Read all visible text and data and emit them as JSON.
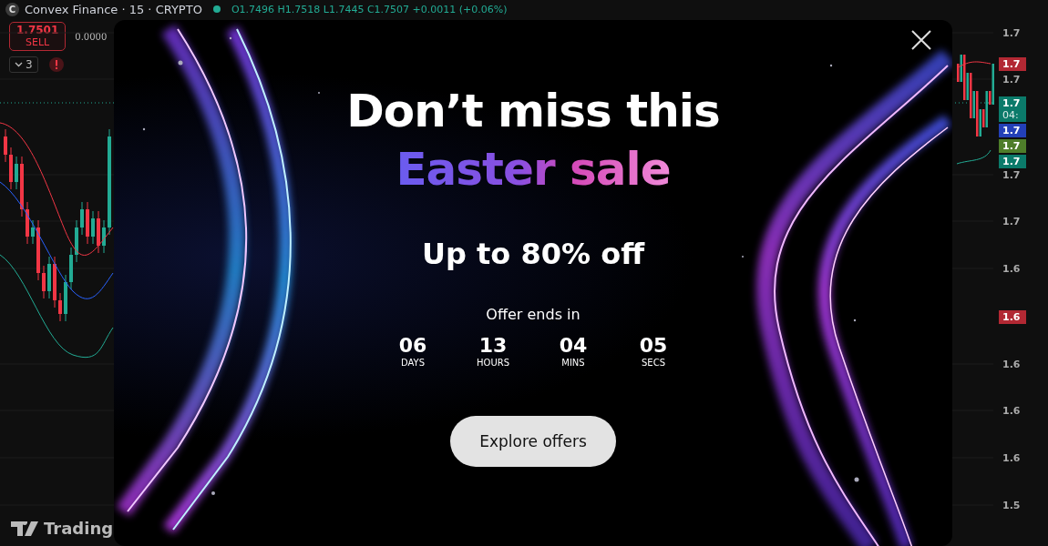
{
  "chart": {
    "symbol_logo": "C",
    "title": "Convex Finance · 15 · CRYPTO",
    "ohlc": "O1.7496 H1.7518 L1.7445 C1.7507 +0.0011 (+0.06%)",
    "sell": {
      "price": "1.7501",
      "label": "SELL"
    },
    "spread": "0.0000",
    "indicators_count": "3",
    "price_axis": [
      {
        "text": "1.7",
        "kind": "plain"
      },
      {
        "text": "1.7",
        "kind": "tag",
        "color": "#b22833"
      },
      {
        "text": "1.7",
        "kind": "plain"
      },
      {
        "text": "1.7",
        "kind": "tag",
        "color": "#0b7a6a",
        "sub": "04:"
      },
      {
        "text": "1.7",
        "kind": "tag",
        "color": "#2340b8"
      },
      {
        "text": "1.7",
        "kind": "tag",
        "color": "#4e7d2a"
      },
      {
        "text": "1.7",
        "kind": "tag",
        "color": "#0b7a6a"
      },
      {
        "text": "1.7",
        "kind": "plain"
      },
      {
        "text": "1.7",
        "kind": "plain"
      },
      {
        "text": "1.6",
        "kind": "plain"
      },
      {
        "text": "1.6",
        "kind": "tag",
        "color": "#b22833"
      },
      {
        "text": "1.6",
        "kind": "plain"
      },
      {
        "text": "1.6",
        "kind": "plain"
      },
      {
        "text": "1.6",
        "kind": "plain"
      },
      {
        "text": "1.5",
        "kind": "plain"
      }
    ],
    "logo_text": "Trading"
  },
  "promo": {
    "title": "Don’t miss this",
    "highlight": "Easter sale",
    "headline": "Up to 80% off",
    "countdown_label": "Offer ends in",
    "countdown": [
      {
        "value": "06",
        "unit": "DAYS"
      },
      {
        "value": "13",
        "unit": "HOURS"
      },
      {
        "value": "04",
        "unit": "MINS"
      },
      {
        "value": "05",
        "unit": "SECS"
      }
    ],
    "button": "Explore offers"
  }
}
